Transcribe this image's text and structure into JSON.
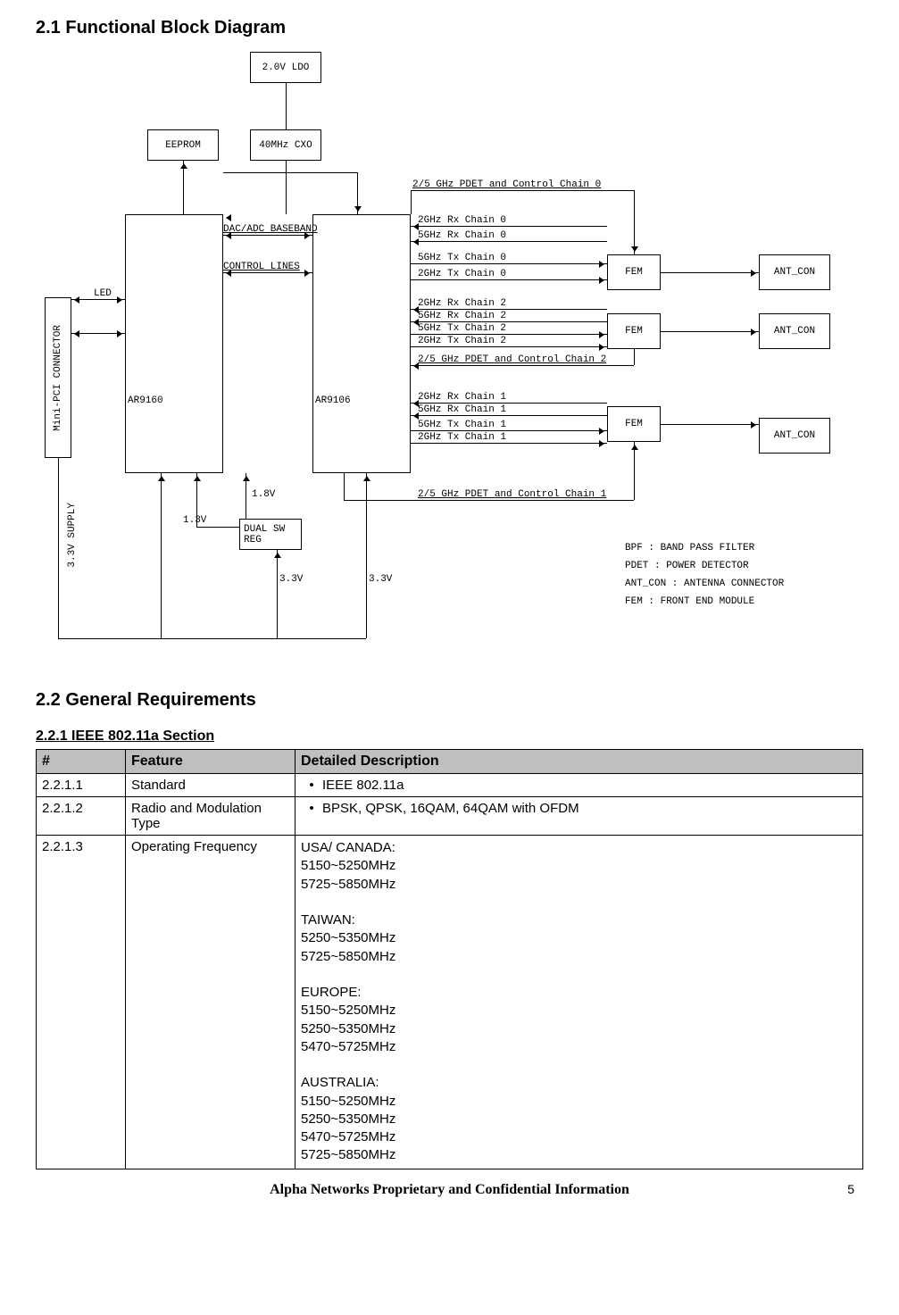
{
  "headings": {
    "h21": "2.1 Functional Block Diagram",
    "h22": "2.2 General Requirements",
    "h221": "2.2.1 IEEE 802.11a Section"
  },
  "diagram": {
    "ldo": "2.0V LDO",
    "eeprom": "EEPROM",
    "cxo": "40MHz CXO",
    "minipci": "Mini-PCI CONNECTOR",
    "ar9160": "AR9160",
    "ar9106": "AR9106",
    "fem": "FEM",
    "antcon": "ANT_CON",
    "dualsw": "DUAL SW\nREG",
    "led": "LED",
    "dacadc": "DAC/ADC BASEBAND",
    "ctrl": "CONTROL LINES",
    "supply": "3.3V SUPPLY",
    "v18": "1.8V",
    "v13": "1.3V",
    "v33a": "3.3V",
    "v33b": "3.3V",
    "pdet0": "2/5 GHz PDET and Control Chain 0",
    "rx2_0": "2GHz Rx Chain 0",
    "rx5_0": "5GHz Rx Chain 0",
    "tx5_0": "5GHz Tx Chain 0",
    "tx2_0": "2GHz Tx Chain 0",
    "rx2_2": "2GHz Rx Chain 2",
    "rx5_2": "5GHz Rx Chain 2",
    "tx5_2": "5GHz Tx Chain 2",
    "tx2_2": "2GHz Tx Chain 2",
    "pdet2": "2/5 GHz PDET and Control Chain 2",
    "rx2_1": "2GHz Rx Chain 1",
    "rx5_1": "5GHz Rx Chain 1",
    "tx5_1": "5GHz Tx Chain 1",
    "tx2_1": "2GHz Tx Chain 1",
    "pdet1": "2/5 GHz PDET and Control Chain 1",
    "legend1": "BPF  : BAND PASS FILTER",
    "legend2": "PDET : POWER DETECTOR",
    "legend3": "ANT_CON  : ANTENNA CONNECTOR",
    "legend4": "FEM : FRONT END MODULE"
  },
  "table": {
    "headers": {
      "num": "#",
      "feature": "Feature",
      "desc": "Detailed Description"
    },
    "rows": [
      {
        "num": "2.2.1.1",
        "feature": "Standard",
        "desc": "IEEE 802.11a",
        "bullet": true
      },
      {
        "num": "2.2.1.2",
        "feature": "Radio and Modulation Type",
        "desc": "BPSK, QPSK, 16QAM, 64QAM with OFDM",
        "bullet": true
      },
      {
        "num": "2.2.1.3",
        "feature": "Operating Frequency",
        "desc": "USA/ CANADA:\n5150~5250MHz\n5725~5850MHz\n\nTAIWAN:\n5250~5350MHz\n5725~5850MHz\n\nEUROPE:\n5150~5250MHz\n5250~5350MHz\n5470~5725MHz\n\nAUSTRALIA:\n5150~5250MHz\n5250~5350MHz\n5470~5725MHz\n5725~5850MHz",
        "bullet": false
      }
    ]
  },
  "footer": {
    "text": "Alpha Networks Proprietary and Confidential Information",
    "page": "5"
  }
}
